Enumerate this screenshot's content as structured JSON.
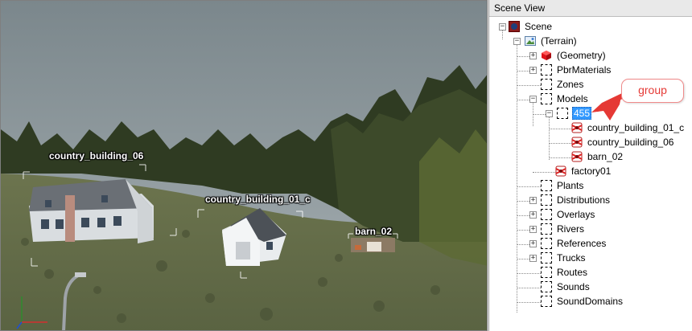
{
  "viewport": {
    "labels": {
      "building_06": "country_building_06",
      "building_01_c": "country_building_01_c",
      "barn": "barn_02"
    }
  },
  "scene_panel": {
    "title": "Scene View",
    "tree": {
      "scene": "Scene",
      "terrain": "(Terrain)",
      "geometry": "(Geometry)",
      "pbr_materials": "PbrMaterials",
      "zones": "Zones",
      "models": "Models",
      "group": "455",
      "model_1": "country_building_01_c",
      "model_2": "country_building_06",
      "model_3": "barn_02",
      "factory": "factory01",
      "plants": "Plants",
      "distributions": "Distributions",
      "overlays": "Overlays",
      "rivers": "Rivers",
      "references": "References",
      "trucks": "Trucks",
      "routes": "Routes",
      "sounds": "Sounds",
      "sound_domains": "SoundDomains"
    }
  },
  "annotation": {
    "callout_text": "group",
    "color": "#e53935"
  },
  "colors": {
    "selection": "#3399ff",
    "sky": "#8a959a",
    "ground": "#6e7550"
  }
}
